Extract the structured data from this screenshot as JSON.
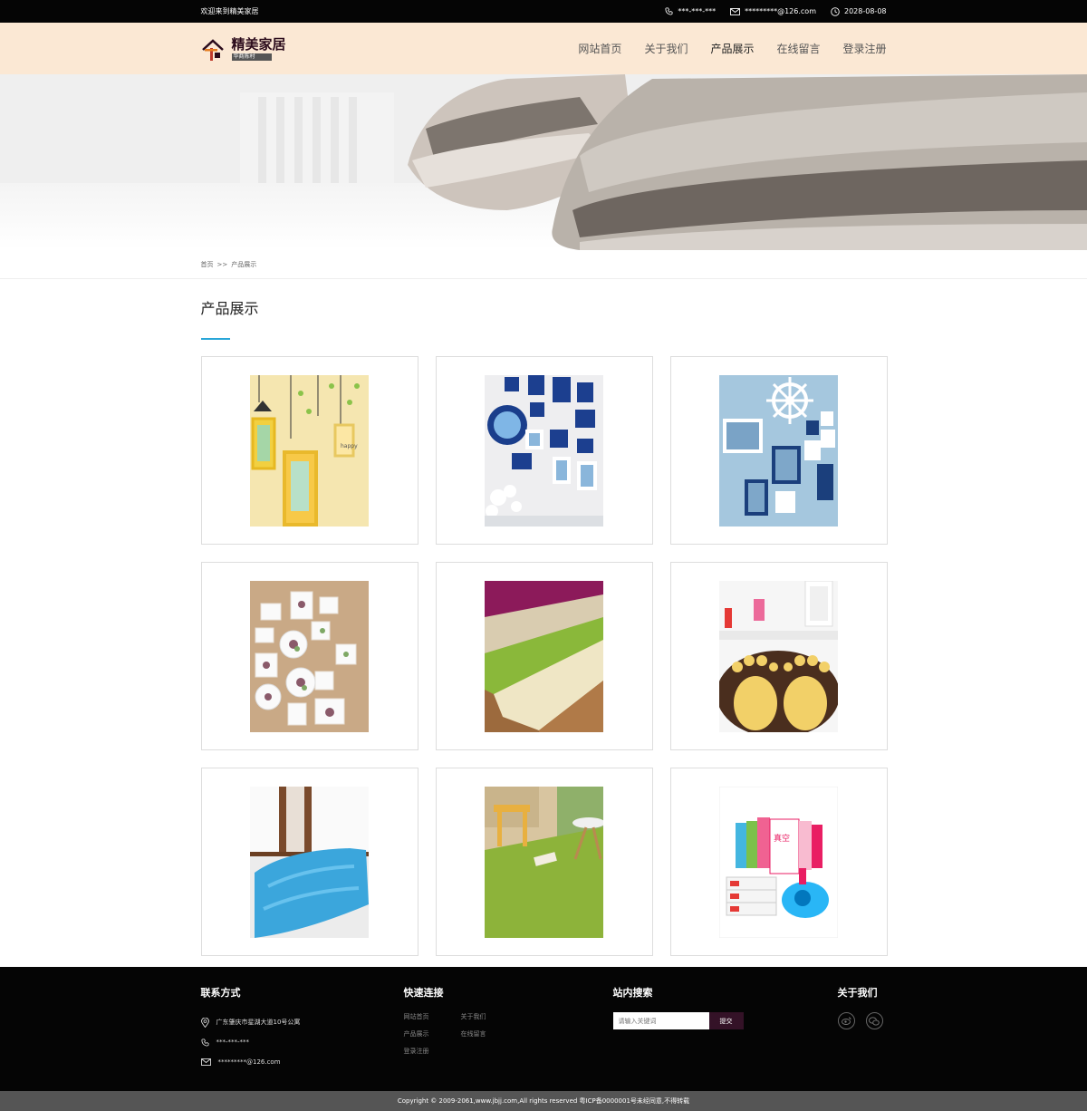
{
  "topbar": {
    "welcome": "欢迎来到精美家居",
    "phone": "***-***-***",
    "email": "*********@126.com",
    "date": "2028-08-08"
  },
  "header": {
    "logo_title": "精美家居",
    "logo_sub": "华商陈村",
    "nav": [
      "网站首页",
      "关于我们",
      "产品展示",
      "在线留言",
      "登录注册"
    ],
    "active_nav": "产品展示"
  },
  "breadcrumb": {
    "home": "首页",
    "sep": ">>",
    "current": "产品展示"
  },
  "section": {
    "title": "产品展示"
  },
  "products": [
    {
      "icon": "photo-wall-birdcage"
    },
    {
      "icon": "photo-wall-blue-frames"
    },
    {
      "icon": "photo-wall-ship-wheel"
    },
    {
      "icon": "photo-wall-floral"
    },
    {
      "icon": "shag-rugs-colors"
    },
    {
      "icon": "footprint-bath-mat"
    },
    {
      "icon": "blue-chenille-mat"
    },
    {
      "icon": "green-shag-rug"
    },
    {
      "icon": "vacuum-storage-bags"
    }
  ],
  "footer": {
    "contact_title": "联系方式",
    "address": "广东肇庆市星湖大道10号公寓",
    "phone": "***-***-***",
    "email": "*********@126.com",
    "links_title": "快速连接",
    "links": [
      "网站首页",
      "关于我们",
      "产品展示",
      "在线留言",
      "登录注册"
    ],
    "search_title": "站内搜索",
    "search_placeholder": "请输入关键词",
    "search_button": "提交",
    "about_title": "关于我们",
    "copyright": "Copyright © 2009-2061,www.jbjj.com,All rights reserved 粤ICP备0000001号未经同意,不得转载"
  },
  "colors": {
    "topbar_bg": "#050505",
    "header_bg": "#fbe8d4",
    "accent_line": "#29a6d8",
    "submit_bg": "#341227",
    "copyright_bg": "#555555"
  }
}
